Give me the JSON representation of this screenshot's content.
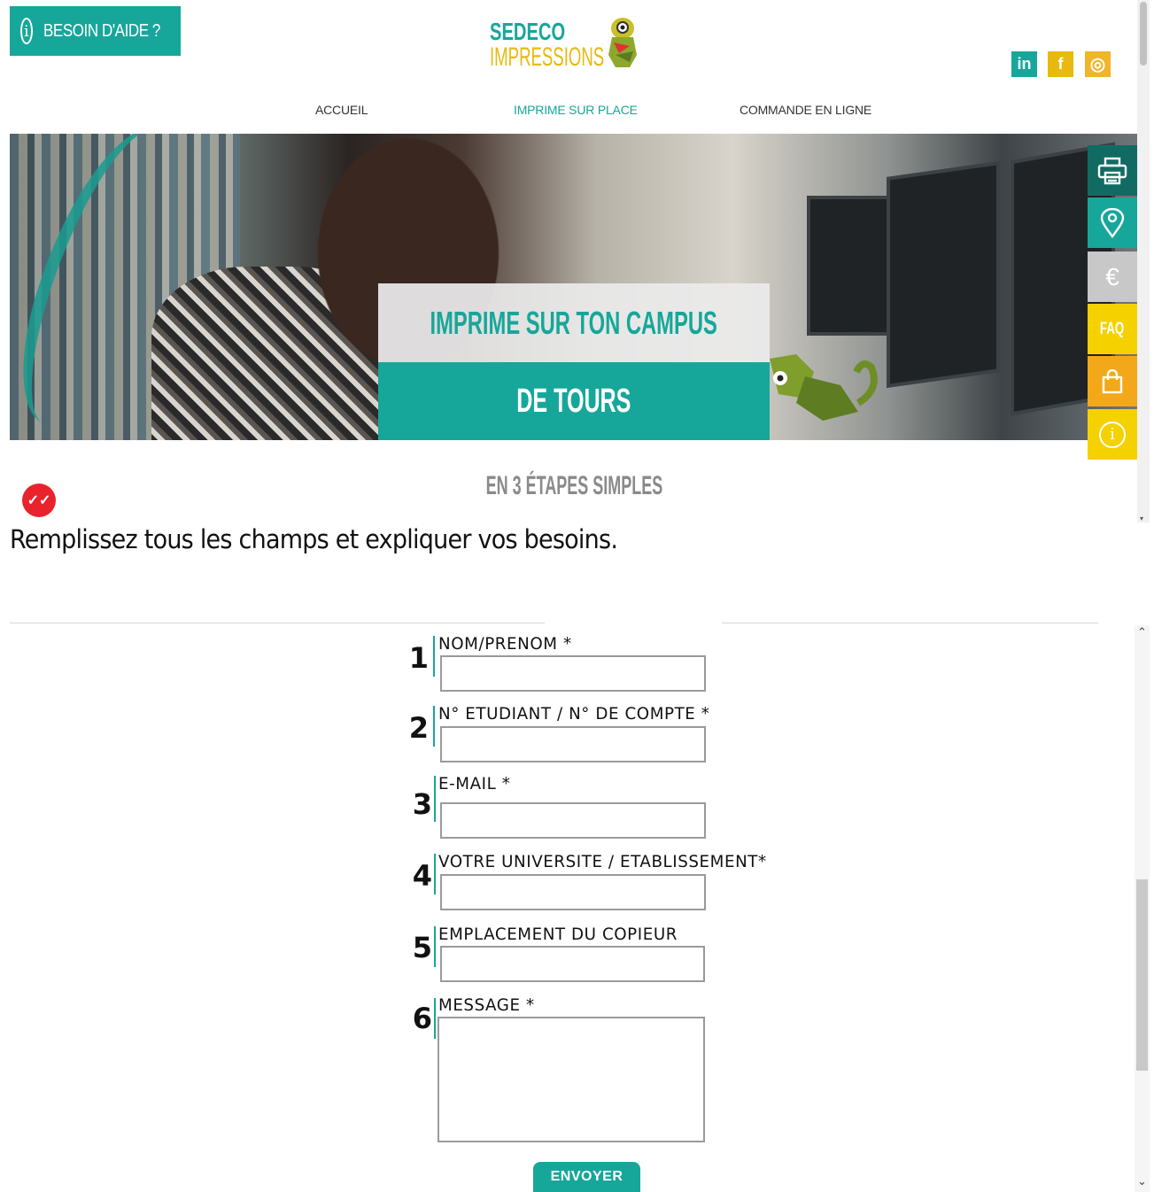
{
  "header": {
    "help_label": "BESOIN D'AIDE ?",
    "logo_line1": "SEDECO",
    "logo_line2": "IMPRESSIONS",
    "social": [
      {
        "icon": "linkedin-icon",
        "glyph": "in",
        "color": "#16a79a"
      },
      {
        "icon": "facebook-icon",
        "glyph": "f",
        "color": "#e8b90e"
      },
      {
        "icon": "instagram-icon",
        "glyph": "◎",
        "color": "#f0b52a"
      }
    ]
  },
  "nav": {
    "items": [
      {
        "label": "ACCUEIL",
        "active": false
      },
      {
        "label": "IMPRIME SUR PLACE",
        "active": true
      },
      {
        "label": "COMMANDE EN LIGNE",
        "active": false
      }
    ],
    "active_color": "#16a79a"
  },
  "hero": {
    "line1": "IMPRIME SUR TON CAMPUS",
    "line2": "DE TOURS"
  },
  "sidebar": [
    {
      "icon": "printer-icon",
      "color": "#116b63"
    },
    {
      "icon": "location-pin-icon",
      "color": "#16a79a"
    },
    {
      "icon": "euro-icon",
      "glyph": "€",
      "color": "#c8c8c8"
    },
    {
      "icon": "faq-icon",
      "glyph": "FAQ",
      "color": "#f5d100"
    },
    {
      "icon": "shopping-bag-icon",
      "color": "#f3a81a"
    },
    {
      "icon": "info-icon",
      "glyph": "i",
      "color": "#f5d100"
    }
  ],
  "steps_title": "EN 3 ÉTAPES SIMPLES",
  "instructions": "Remplissez tous les champs et expliquer vos besoins.",
  "form": {
    "fields": [
      {
        "number": "1",
        "label": "NOM/PRENOM *",
        "value": ""
      },
      {
        "number": "2",
        "label": "N° ETUDIANT / N° DE COMPTE *",
        "value": ""
      },
      {
        "number": "3",
        "label": "E-MAIL *",
        "value": ""
      },
      {
        "number": "4",
        "label": "VOTRE UNIVERSITE / ETABLISSEMENT*",
        "value": ""
      },
      {
        "number": "5",
        "label": "EMPLACEMENT DU COPIEUR",
        "value": ""
      },
      {
        "number": "6",
        "label": "MESSAGE *",
        "value": ""
      }
    ],
    "submit_label": "ENVOYER"
  },
  "colors": {
    "brand_teal": "#16a79a",
    "brand_yellow": "#e8b90e",
    "badge_red": "#e8232d"
  }
}
